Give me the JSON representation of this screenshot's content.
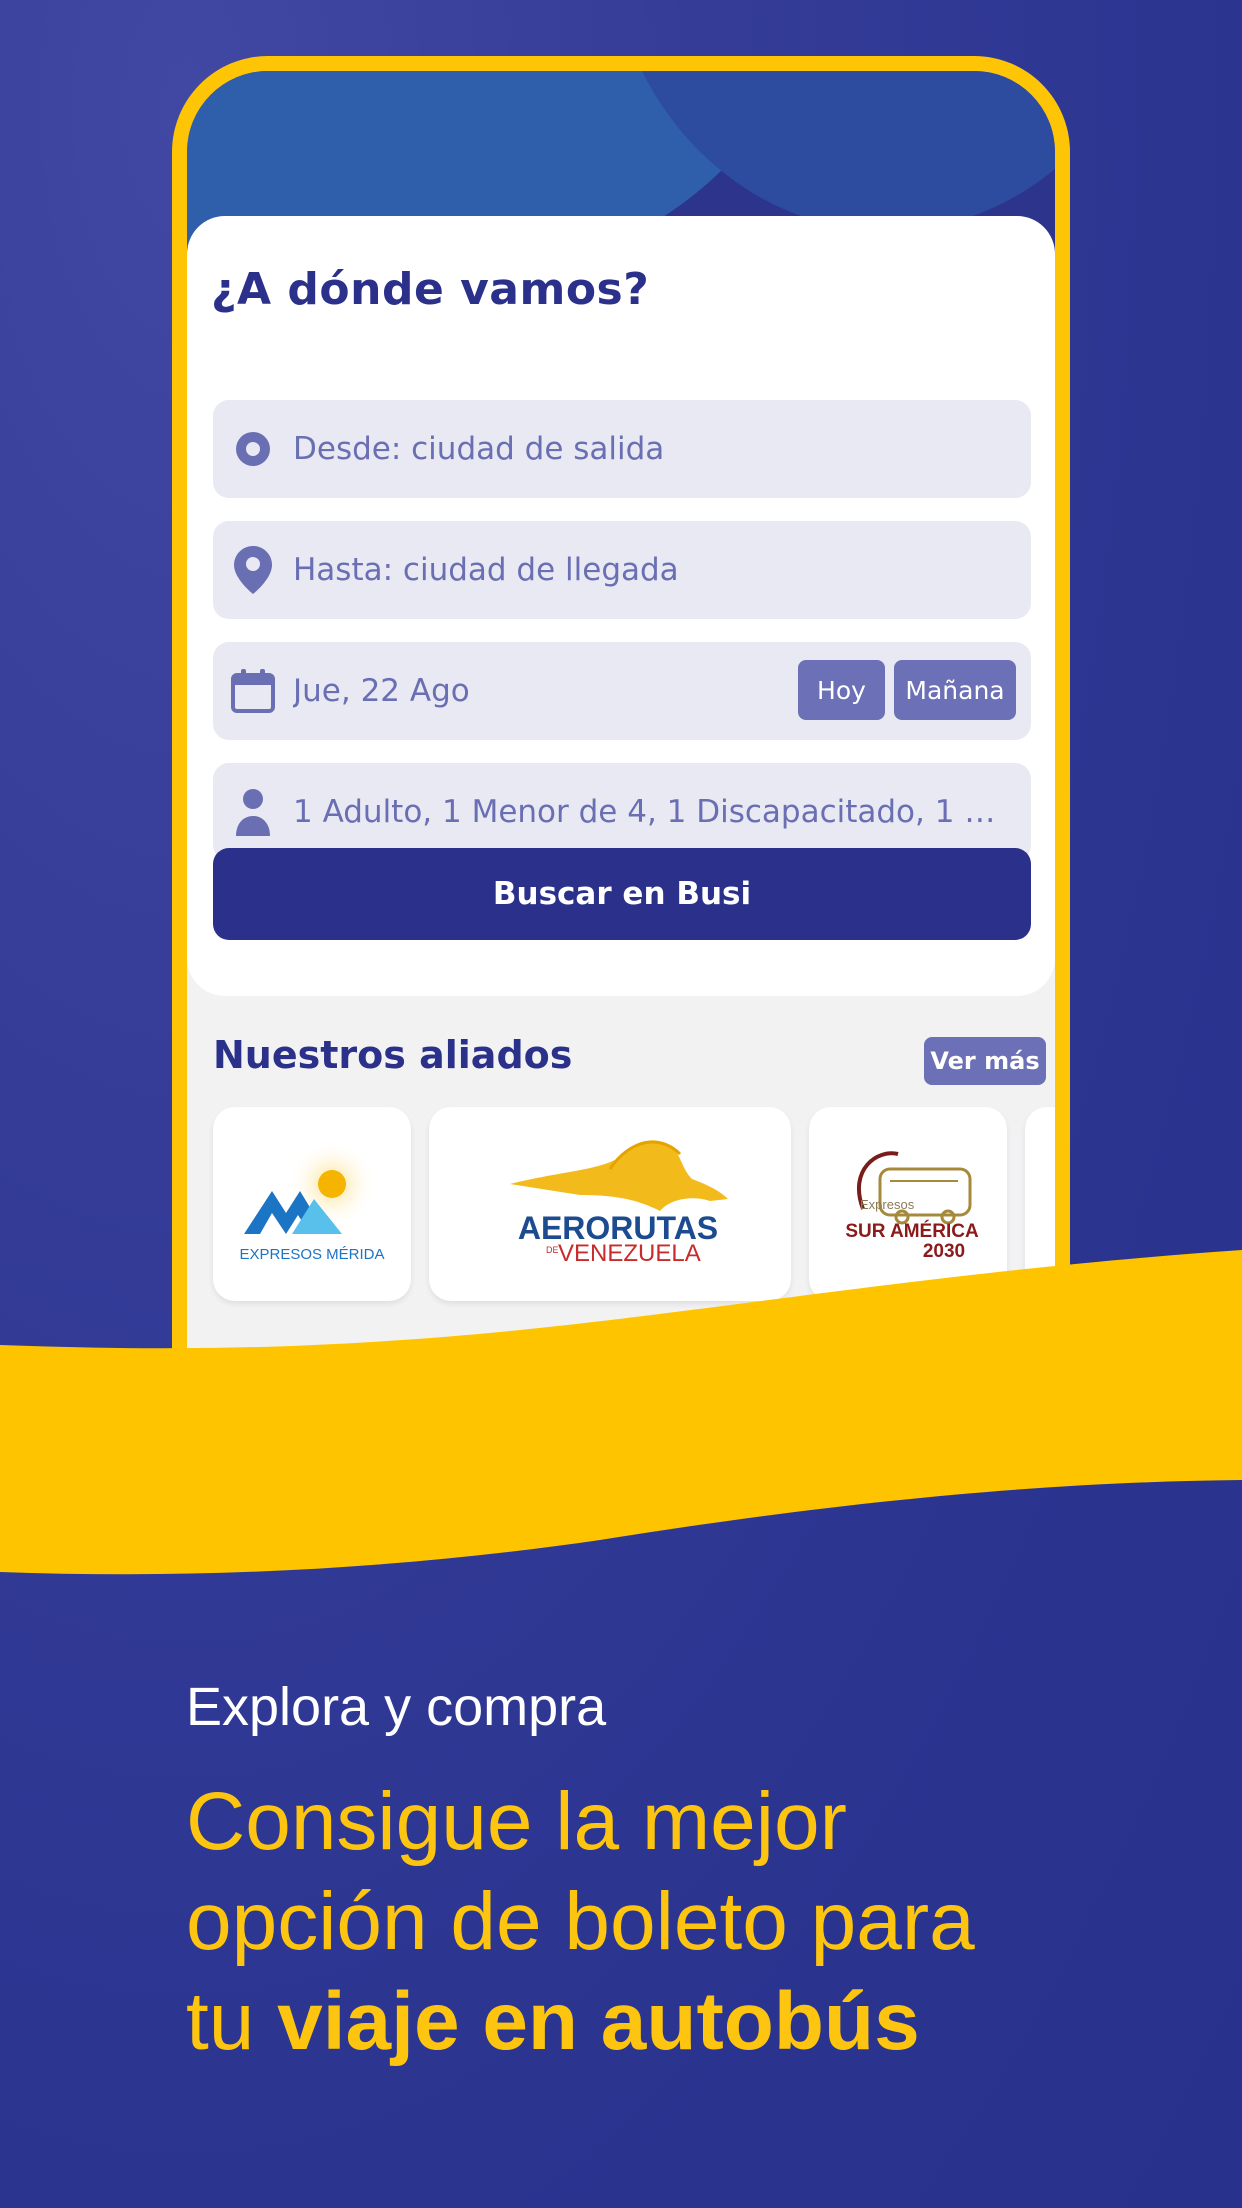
{
  "search_card": {
    "title": "¿A dónde vamos?",
    "from_placeholder": "Desde: ciudad de salida",
    "to_placeholder": "Hasta: ciudad de llegada",
    "date_value": "Jue, 22 Ago",
    "today_label": "Hoy",
    "tomorrow_label": "Mañana",
    "passengers_value": "1 Adulto, 1 Menor de 4, 1 Discapacitado, 1 M...",
    "search_button": "Buscar en Busi"
  },
  "allies": {
    "title": "Nuestros aliados",
    "see_more": "Ver más",
    "items": [
      {
        "name": "EXPRESOS MÉRIDA"
      },
      {
        "name_line1": "AERORUTAS",
        "name_line2_prefix": "DE",
        "name_line2": "VENEZUELA"
      },
      {
        "name_small": "Expresos",
        "name_line1": "SUR AMÉRICA",
        "name_line2": "2030"
      }
    ]
  },
  "footer": {
    "subtitle": "Explora y compra",
    "headline_line1": "Consigue la mejor",
    "headline_line2": "opción de boleto para",
    "headline_line3_prefix": "tu ",
    "headline_line3_bold": "viaje en autobús"
  },
  "colors": {
    "background": "#2b3590",
    "accent_yellow": "#fdc505",
    "primary_navy": "#2b318a",
    "chip_purple": "#6c70b6",
    "field_bg": "#e8e9f2"
  }
}
